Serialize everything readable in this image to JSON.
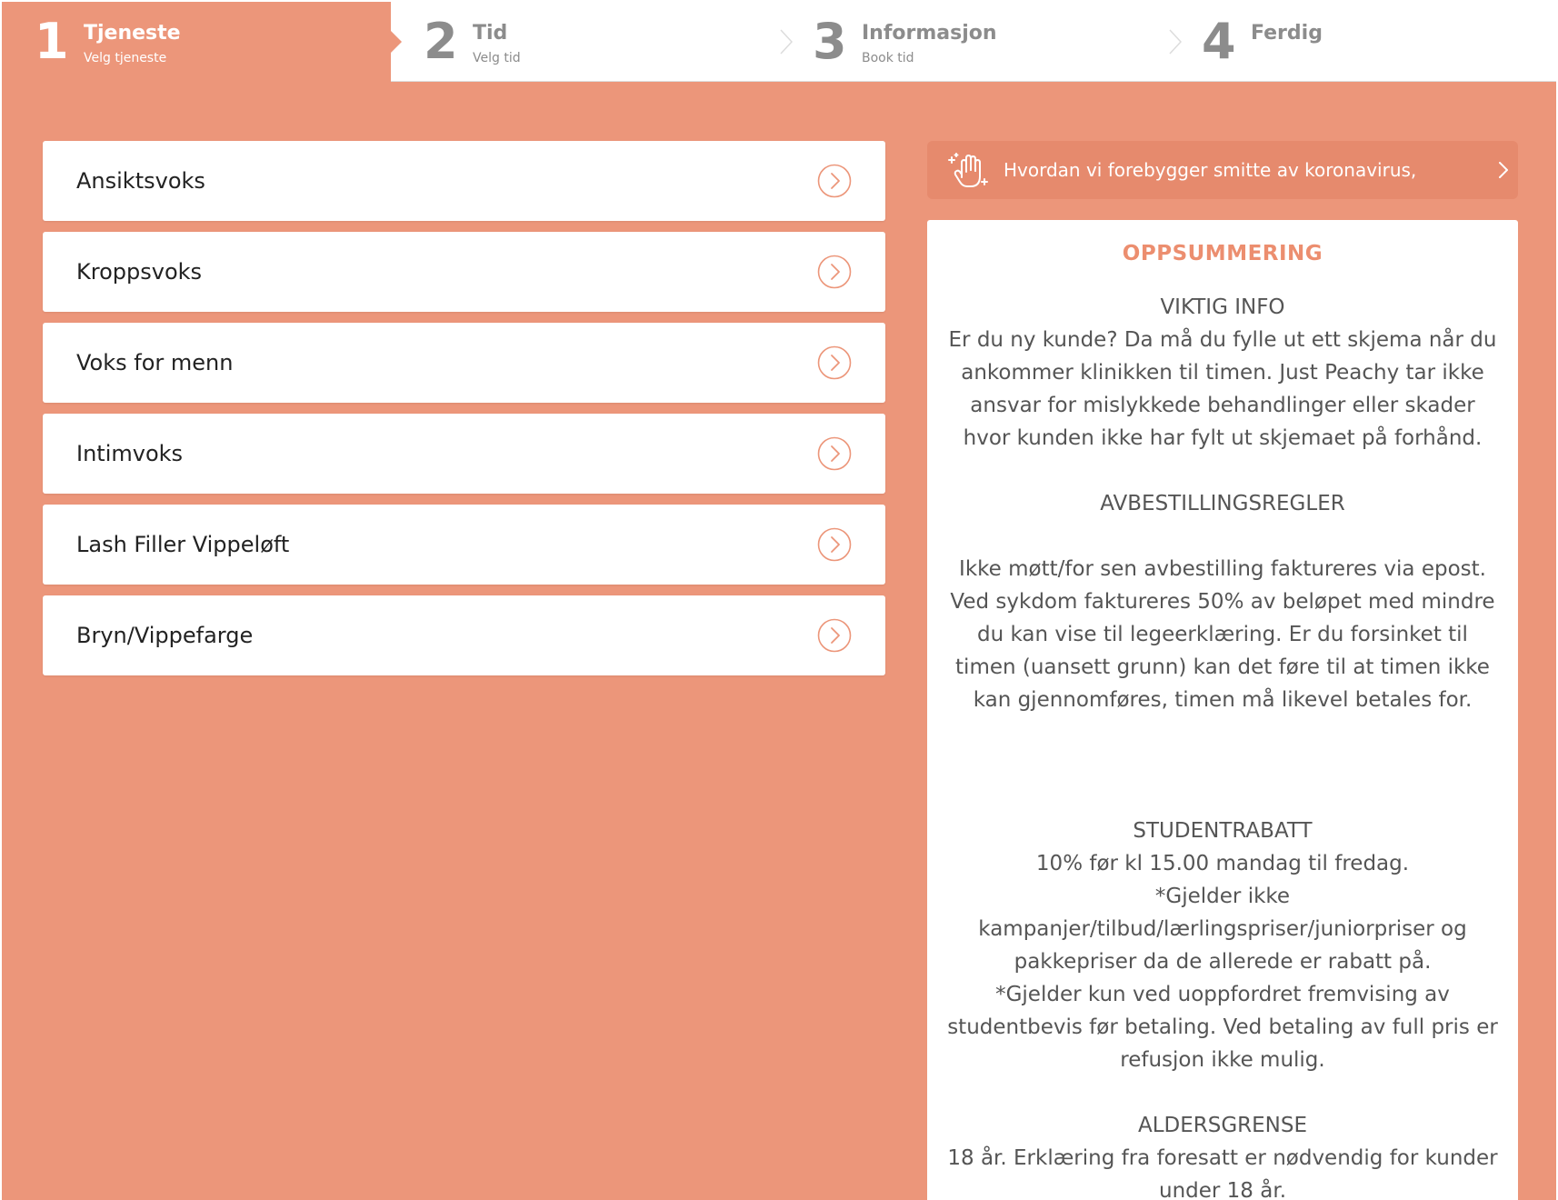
{
  "colors": {
    "primary": "#ec967a",
    "accent_text": "#ec8e6f",
    "step_inactive": "#8c8c8c",
    "banner": "#e68a6d"
  },
  "stepper": [
    {
      "number": "1",
      "title": "Tjeneste",
      "subtitle": "Velg tjeneste",
      "active": true
    },
    {
      "number": "2",
      "title": "Tid",
      "subtitle": "Velg tid",
      "active": false
    },
    {
      "number": "3",
      "title": "Informasjon",
      "subtitle": "Book tid",
      "active": false
    },
    {
      "number": "4",
      "title": "Ferdig",
      "subtitle": "",
      "active": false
    }
  ],
  "services": [
    {
      "label": "Ansiktsvoks",
      "icon": "chevron-right-circle-icon"
    },
    {
      "label": "Kroppsvoks",
      "icon": "chevron-right-circle-icon"
    },
    {
      "label": "Voks for menn",
      "icon": "chevron-right-circle-icon"
    },
    {
      "label": "Intimvoks",
      "icon": "chevron-right-circle-icon"
    },
    {
      "label": "Lash Filler Vippeløft",
      "icon": "chevron-right-circle-icon"
    },
    {
      "label": "Bryn/Vippefarge",
      "icon": "chevron-right-circle-icon"
    }
  ],
  "banner": {
    "icon": "clean-hand-icon",
    "text": "Hvordan vi forebygger smitte av koronavirus,"
  },
  "summary": {
    "title": "OPPSUMMERING",
    "viktig_heading": "VIKTIG INFO",
    "viktig_text": "Er du ny kunde? Da må du fylle ut ett skjema når du ankommer klinikken til timen. Just Peachy tar ikke ansvar for mislykkede behandlinger eller skader hvor kunden ikke har fylt ut skjemaet på forhånd.",
    "avbest_heading": "AVBESTILLINGSREGLER",
    "avbest_text": "Ikke møtt/for sen avbestilling faktureres via epost. Ved sykdom faktureres 50% av beløpet med mindre du kan vise til legeerklæring. Er du forsinket til timen (uansett grunn) kan det føre til at timen ikke kan gjennomføres, timen må likevel betales for.",
    "student_heading": "STUDENTRABATT",
    "student_line1": "10% før kl 15.00 mandag til fredag.",
    "student_line2": "*Gjelder ikke kampanjer/tilbud/lærlingspriser/juniorpriser og pakkepriser da de allerede er rabatt på.",
    "student_line3": "*Gjelder kun ved uoppfordret fremvising av studentbevis før betaling. Ved betaling av full pris er refusjon ikke mulig.",
    "alder_heading": "ALDERSGRENSE",
    "alder_text": "18 år. Erklæring fra foresatt er nødvendig for kunder under 18 år."
  }
}
